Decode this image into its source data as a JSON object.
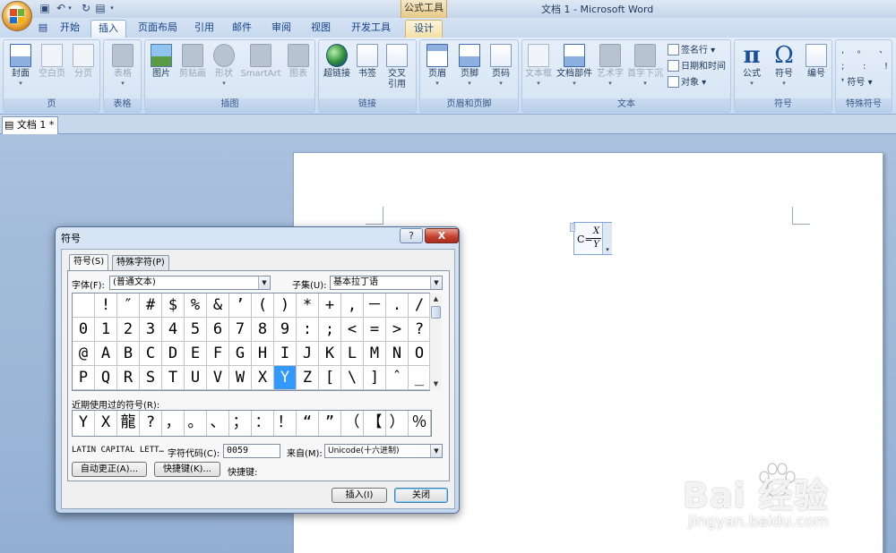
{
  "window": {
    "title": "文档 1 - Microsoft Word",
    "contextual_tab_group": "公式工具"
  },
  "tabs": [
    {
      "label": "开始"
    },
    {
      "label": "插入"
    },
    {
      "label": "页面布局"
    },
    {
      "label": "引用"
    },
    {
      "label": "邮件"
    },
    {
      "label": "审阅"
    },
    {
      "label": "视图"
    },
    {
      "label": "开发工具"
    },
    {
      "label": "设计"
    }
  ],
  "ribbon": {
    "groups": {
      "page": {
        "label": "页",
        "cover": "封面",
        "blank": "空白页",
        "break": "分页"
      },
      "table": {
        "label": "表格",
        "table": "表格"
      },
      "illustrations": {
        "label": "插图",
        "picture": "图片",
        "clipart": "剪贴画",
        "shapes": "形状",
        "smartart": "SmartArt",
        "chart": "图表"
      },
      "links": {
        "label": "链接",
        "hyperlink": "超链接",
        "bookmark": "书签",
        "crossref_1": "交叉",
        "crossref_2": "引用"
      },
      "header_footer": {
        "label": "页眉和页脚",
        "header": "页眉",
        "footer": "页脚",
        "page_number": "页码"
      },
      "text": {
        "label": "文本",
        "textbox": "文本框",
        "quickparts": "文档部件",
        "wordart": "艺术字",
        "dropcap": "首字下沉",
        "signature": "签名行",
        "datetime": "日期和时间",
        "object": "对象"
      },
      "symbols": {
        "label": "符号",
        "equation": "公式",
        "symbol": "符号",
        "number": "编号",
        "pi": "π",
        "omega": "Ω"
      },
      "special": {
        "label": "特殊符号",
        "row1": [
          ",",
          "。",
          "、"
        ],
        "row2": [
          ";",
          ":",
          "!"
        ],
        "symbol_btn": "符号"
      }
    }
  },
  "document": {
    "tab_label": "文档 1 *",
    "equation": {
      "lhs": "C=",
      "numerator": "X",
      "denominator": "Y"
    }
  },
  "dialog": {
    "title": "符号",
    "help": "?",
    "close": "X",
    "tabs": {
      "symbols": "符号(S)",
      "special": "特殊字符(P)"
    },
    "font_label": "字体(F):",
    "font_value": "(普通文本)",
    "subset_label": "子集(U):",
    "subset_value": "基本拉丁语",
    "symbol_rows": [
      [
        " ",
        "!",
        "″",
        "#",
        "$",
        "%",
        "&",
        "’",
        "(",
        ")",
        "*",
        "+",
        ",",
        "－",
        ".",
        "/"
      ],
      [
        "0",
        "1",
        "2",
        "3",
        "4",
        "5",
        "6",
        "7",
        "8",
        "9",
        ":",
        ";",
        "<",
        "=",
        ">",
        "?"
      ],
      [
        "@",
        "A",
        "B",
        "C",
        "D",
        "E",
        "F",
        "G",
        "H",
        "I",
        "J",
        "K",
        "L",
        "M",
        "N",
        "O"
      ],
      [
        "P",
        "Q",
        "R",
        "S",
        "T",
        "U",
        "V",
        "W",
        "X",
        "Y",
        "Z",
        "[",
        "\\",
        "]",
        "ˆ",
        "_"
      ]
    ],
    "selected_symbol": "Y",
    "recent_label": "近期使用过的符号(R):",
    "recent_symbols": [
      "Y",
      "X",
      "龍",
      "?",
      "，",
      "。",
      "、",
      "；",
      "：",
      "！",
      "“",
      "”",
      "（",
      "【",
      "）",
      "％"
    ],
    "char_name": "LATIN CAPITAL LETT…",
    "char_code_label": "字符代码(C):",
    "char_code_value": "0059",
    "from_label": "来自(M):",
    "from_value": "Unicode(十六进制)",
    "autocorrect_btn": "自动更正(A)...",
    "shortcut_btn": "快捷键(K)...",
    "shortcut_label": "快捷键:",
    "insert_btn": "插入(I)",
    "close_btn": "关闭"
  },
  "watermark": {
    "brand": "Bai 经验",
    "url": "jingyan.baidu.com"
  }
}
